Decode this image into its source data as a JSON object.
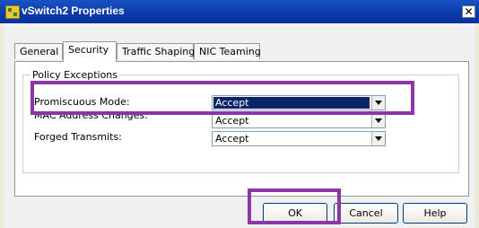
{
  "window": {
    "title": "vSwitch2 Properties",
    "close_glyph": "✕"
  },
  "tabs": [
    {
      "label": "General"
    },
    {
      "label": "Security"
    },
    {
      "label": "Traffic Shaping"
    },
    {
      "label": "NIC Teaming"
    }
  ],
  "policy": {
    "group_label": "Policy Exceptions",
    "rows": [
      {
        "label": "Promiscuous Mode:",
        "value": "Accept"
      },
      {
        "label": "MAC Address Changes:",
        "value": "Accept"
      },
      {
        "label": "Forged Transmits:",
        "value": "Accept"
      }
    ]
  },
  "buttons": {
    "ok": "OK",
    "cancel": "Cancel",
    "help": "Help"
  },
  "colors": {
    "highlight": "#8a35a8",
    "title_bar": "#0a3aa9",
    "selection": "#0a246a"
  }
}
